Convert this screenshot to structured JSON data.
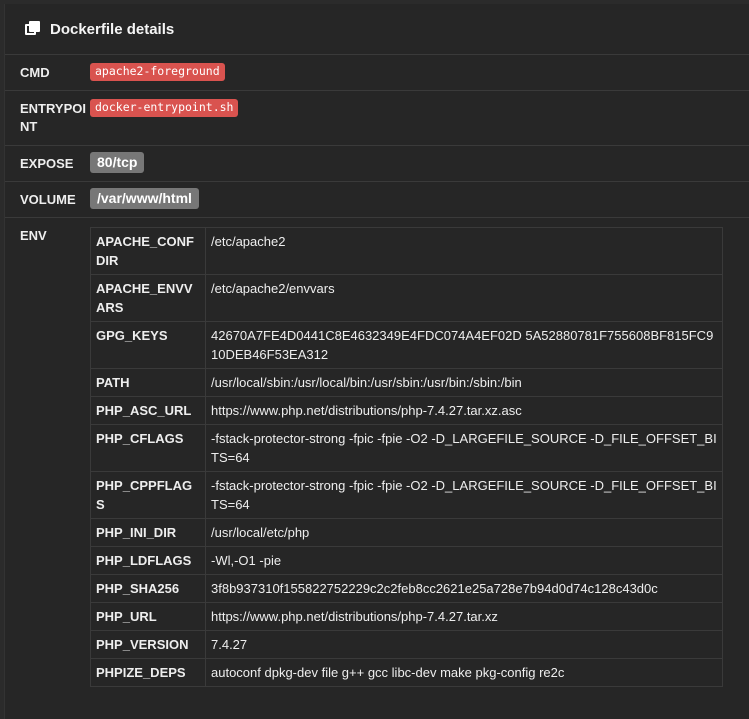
{
  "header": {
    "title": "Dockerfile details",
    "icon": "copy-icon"
  },
  "rows": {
    "cmd": {
      "key": "CMD",
      "value": "apache2-foreground"
    },
    "entrypoint": {
      "key": "ENTRYPOINT",
      "value": "docker-entrypoint.sh"
    },
    "expose": {
      "key": "EXPOSE",
      "value": "80/tcp"
    },
    "volume": {
      "key": "VOLUME",
      "value": "/var/www/html"
    },
    "env": {
      "key": "ENV"
    }
  },
  "env": [
    {
      "name": "APACHE_CONFDIR",
      "value": "/etc/apache2"
    },
    {
      "name": "APACHE_ENVVARS",
      "value": "/etc/apache2/envvars"
    },
    {
      "name": "GPG_KEYS",
      "value": "42670A7FE4D0441C8E4632349E4FDC074A4EF02D 5A52880781F755608BF815FC910DEB46F53EA312"
    },
    {
      "name": "PATH",
      "value": "/usr/local/sbin:/usr/local/bin:/usr/sbin:/usr/bin:/sbin:/bin"
    },
    {
      "name": "PHP_ASC_URL",
      "value": "https://www.php.net/distributions/php-7.4.27.tar.xz.asc"
    },
    {
      "name": "PHP_CFLAGS",
      "value": "-fstack-protector-strong -fpic -fpie -O2 -D_LARGEFILE_SOURCE -D_FILE_OFFSET_BITS=64"
    },
    {
      "name": "PHP_CPPFLAGS",
      "value": "-fstack-protector-strong -fpic -fpie -O2 -D_LARGEFILE_SOURCE -D_FILE_OFFSET_BITS=64"
    },
    {
      "name": "PHP_INI_DIR",
      "value": "/usr/local/etc/php"
    },
    {
      "name": "PHP_LDFLAGS",
      "value": "-Wl,-O1 -pie"
    },
    {
      "name": "PHP_SHA256",
      "value": "3f8b937310f155822752229c2c2feb8cc2621e25a728e7b94d0d74c128c43d0c"
    },
    {
      "name": "PHP_URL",
      "value": "https://www.php.net/distributions/php-7.4.27.tar.xz"
    },
    {
      "name": "PHP_VERSION",
      "value": "7.4.27"
    },
    {
      "name": "PHPIZE_DEPS",
      "value": "autoconf dpkg-dev file g++ gcc libc-dev make pkg-config re2c"
    }
  ],
  "colors": {
    "code_badge": "#d9534f",
    "gray_badge": "#777777",
    "background": "#262626"
  }
}
